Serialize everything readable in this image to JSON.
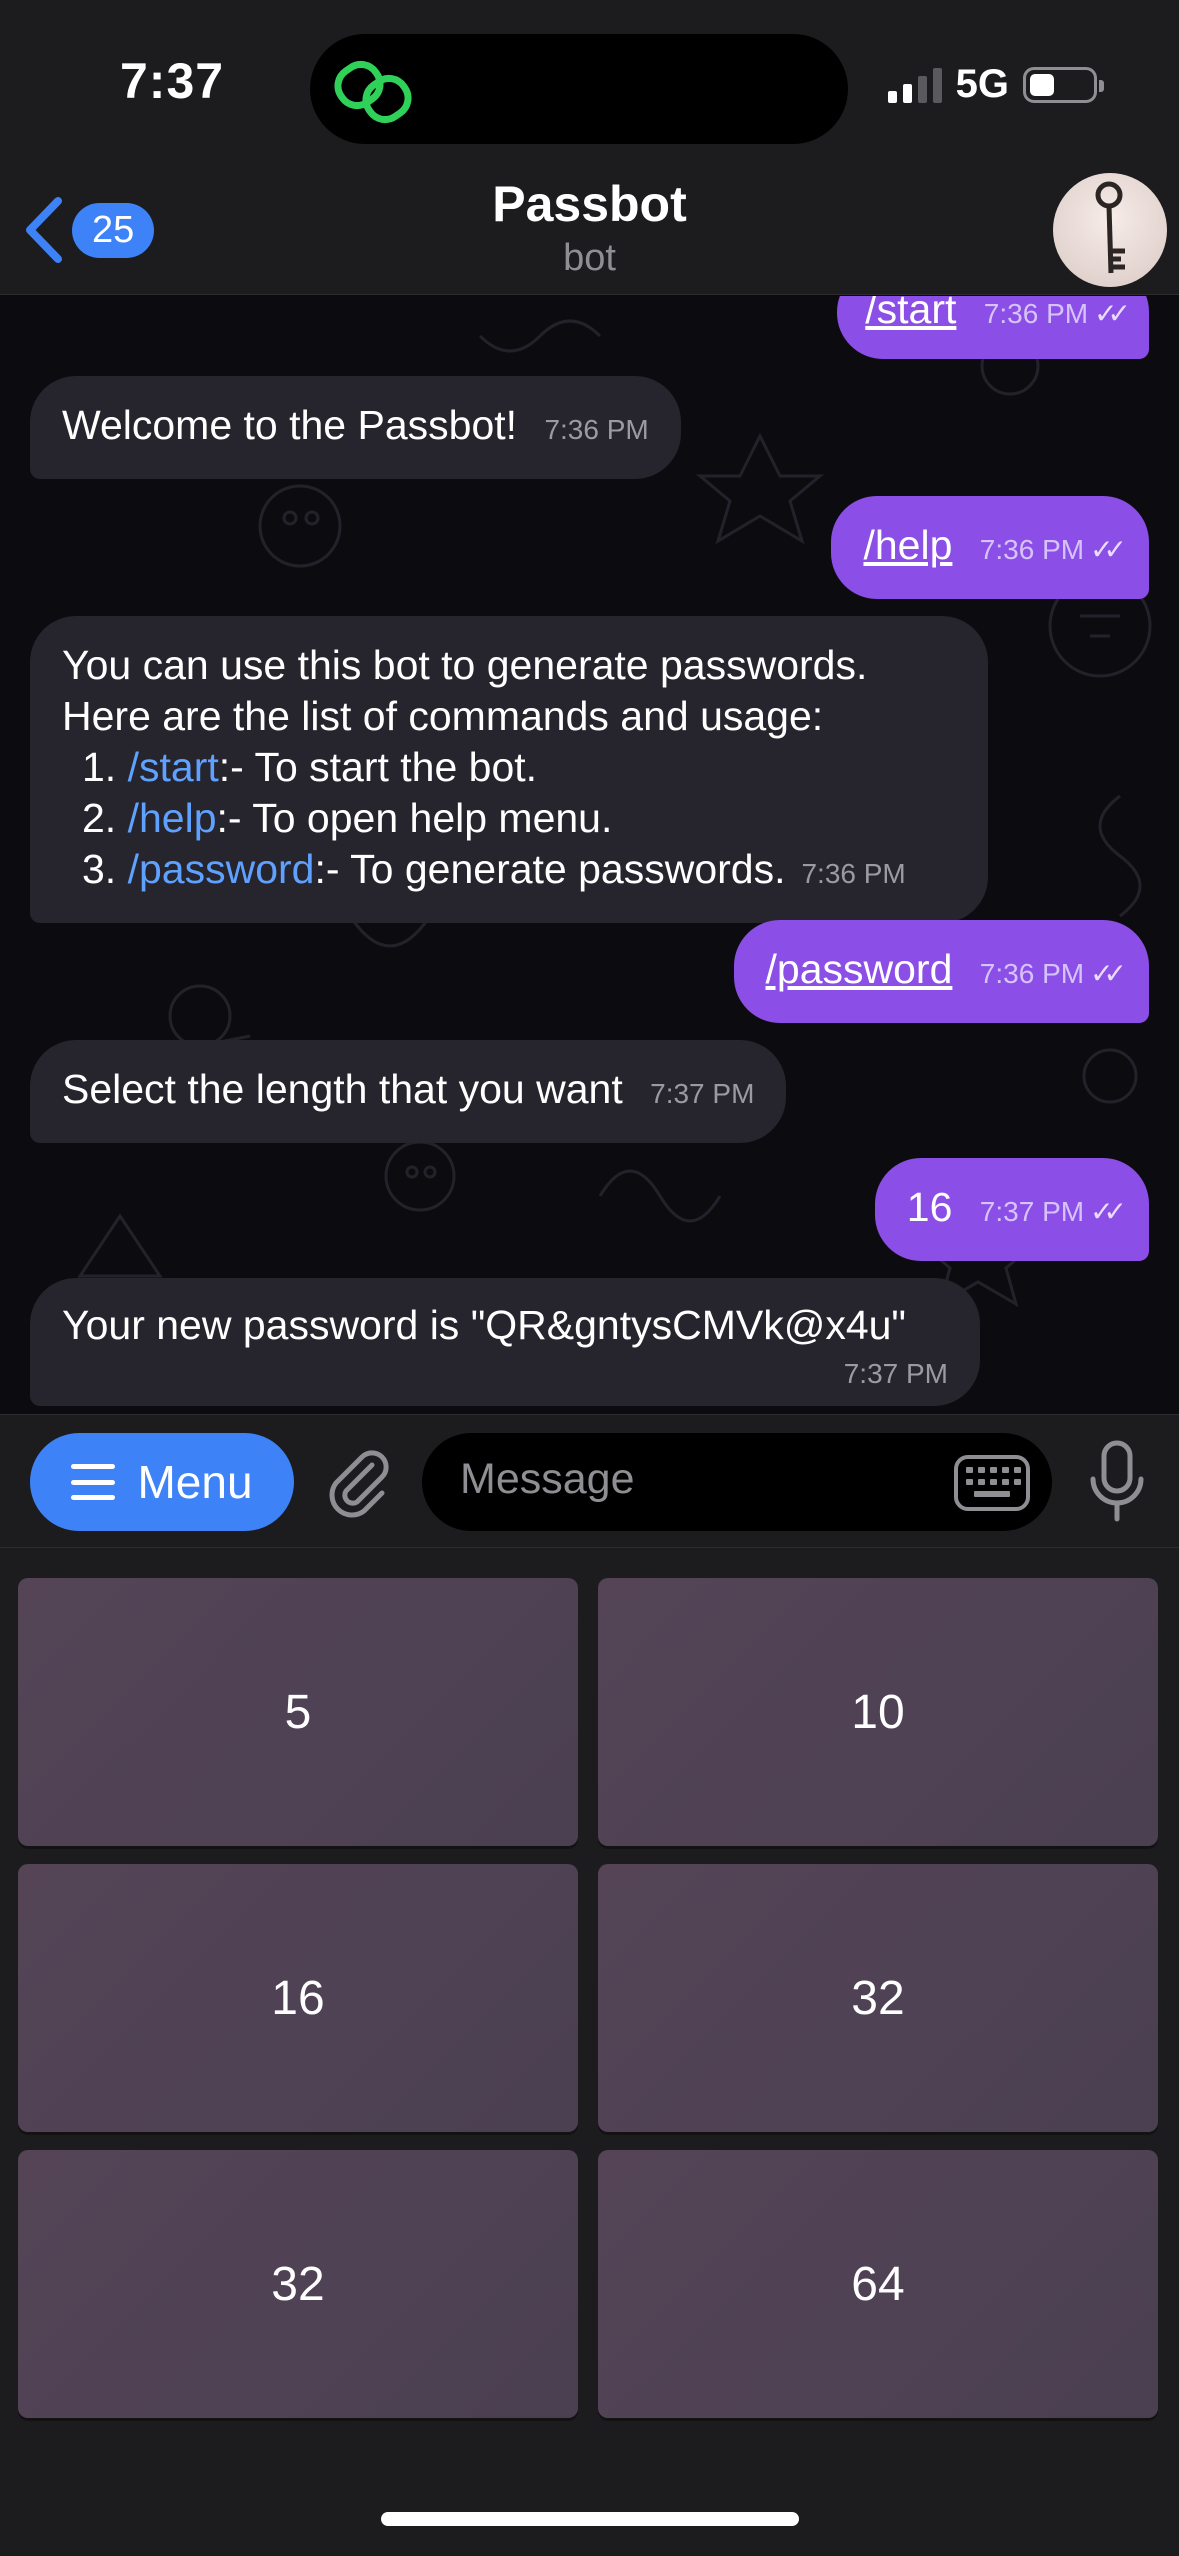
{
  "status_bar": {
    "time": "7:37",
    "network": "5G"
  },
  "header": {
    "back_count": "25",
    "title": "Passbot",
    "subtitle": "bot"
  },
  "messages": [
    {
      "dir": "out",
      "text": "/start",
      "time": "7:36 PM"
    },
    {
      "dir": "in",
      "text": "Welcome to the Passbot!",
      "time": "7:36 PM"
    },
    {
      "dir": "out",
      "text": "/help",
      "time": "7:36 PM"
    },
    {
      "dir": "in",
      "intro_1": "You can use this bot to generate passwords.",
      "intro_2": "Here are the list of commands and usage:",
      "items": [
        {
          "num": "1.",
          "cmd": "/start",
          "desc": ":- To start the bot."
        },
        {
          "num": "2.",
          "cmd": "/help",
          "desc": ":- To open help menu."
        },
        {
          "num": "3.",
          "cmd": "/password",
          "desc": ":- To generate passwords."
        }
      ],
      "time": "7:36 PM"
    },
    {
      "dir": "out",
      "text": "/password",
      "time": "7:36 PM"
    },
    {
      "dir": "in",
      "text": "Select the length that you want",
      "time": "7:37 PM"
    },
    {
      "dir": "out",
      "text": "16",
      "time": "7:37 PM"
    },
    {
      "dir": "in",
      "text": "Your new password is \"QR&gntysCMVk@x4u\"",
      "time": "7:37 PM"
    }
  ],
  "input_bar": {
    "menu_label": "Menu",
    "placeholder": "Message"
  },
  "reply_keyboard": [
    "5",
    "10",
    "16",
    "32",
    "32",
    "64"
  ],
  "colors": {
    "accent": "#3e82f7",
    "outgoing_bubble": "#8b4ee6",
    "incoming_bubble": "#26242c",
    "link": "#5ea1ff"
  }
}
